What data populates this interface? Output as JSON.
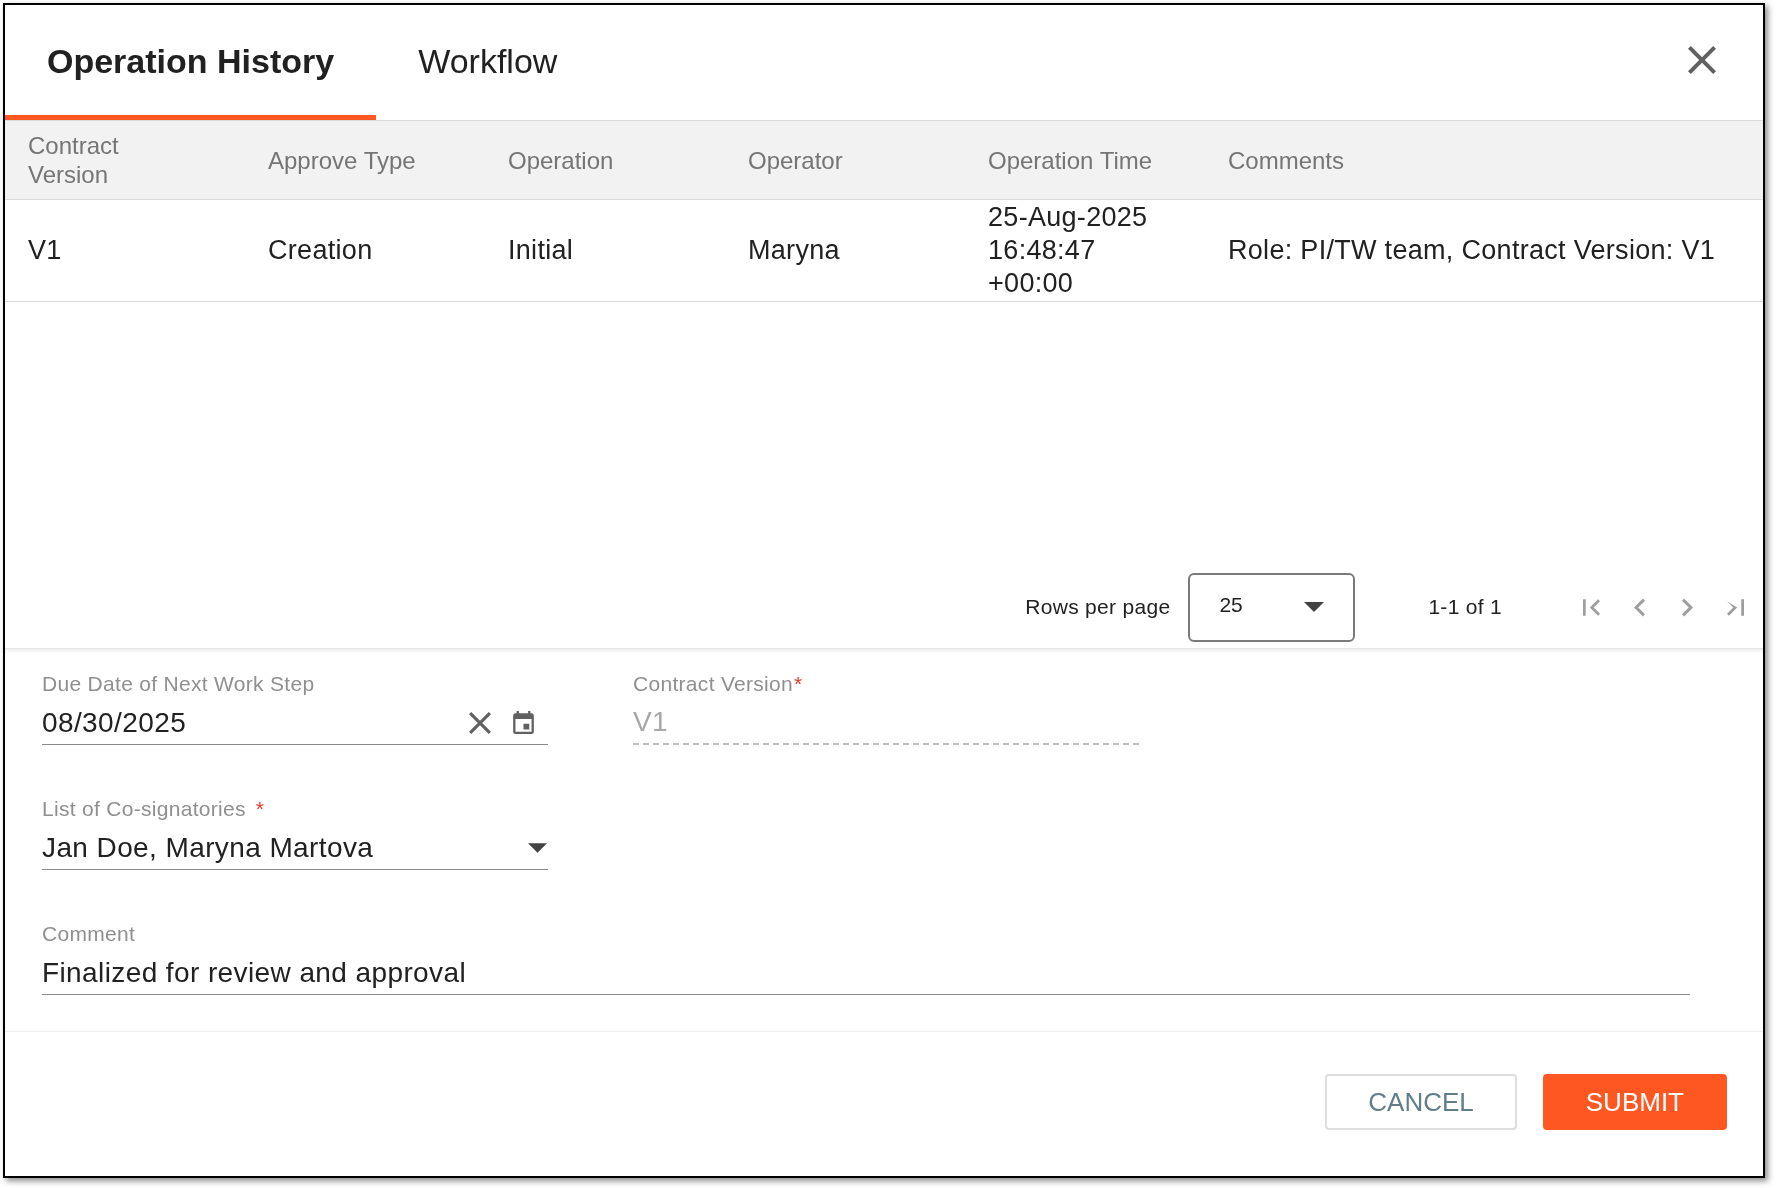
{
  "tabs": [
    {
      "label": "Operation History",
      "selected": true
    },
    {
      "label": "Workflow",
      "selected": false
    }
  ],
  "table": {
    "columns": [
      "Contract Version",
      "Approve Type",
      "Operation",
      "Operator",
      "Operation Time",
      "Comments"
    ],
    "rows": [
      [
        "V1",
        "Creation",
        "Initial",
        "Maryna",
        "25-Aug-2025 16:48:47 +00:00",
        "Role: PI/TW team, Contract Version: V1"
      ]
    ]
  },
  "pagination": {
    "rows_per_page_label": "Rows per page",
    "rows_per_page": "25",
    "range": "1-1 of 1"
  },
  "form": {
    "rows": [
      [
        {
          "kind": "date",
          "label": "Due Date of Next Work Step",
          "value": "08/30/2025",
          "disabled": false
        },
        {
          "kind": "text",
          "label": "Contract Version",
          "required_mark": "*",
          "value": "V1",
          "disabled": true
        }
      ],
      [
        {
          "kind": "select",
          "label": "List of Co-signatories",
          "required_mark": "*",
          "value": "Jan Doe, Maryna Martova",
          "disabled": false
        }
      ],
      [
        {
          "kind": "text",
          "label": "Comment",
          "value": "Finalized for review and approval",
          "disabled": false
        }
      ]
    ]
  },
  "buttons": [
    {
      "label": "CANCEL",
      "kind": "outlined"
    },
    {
      "label": "SUBMIT",
      "kind": "primary"
    }
  ]
}
